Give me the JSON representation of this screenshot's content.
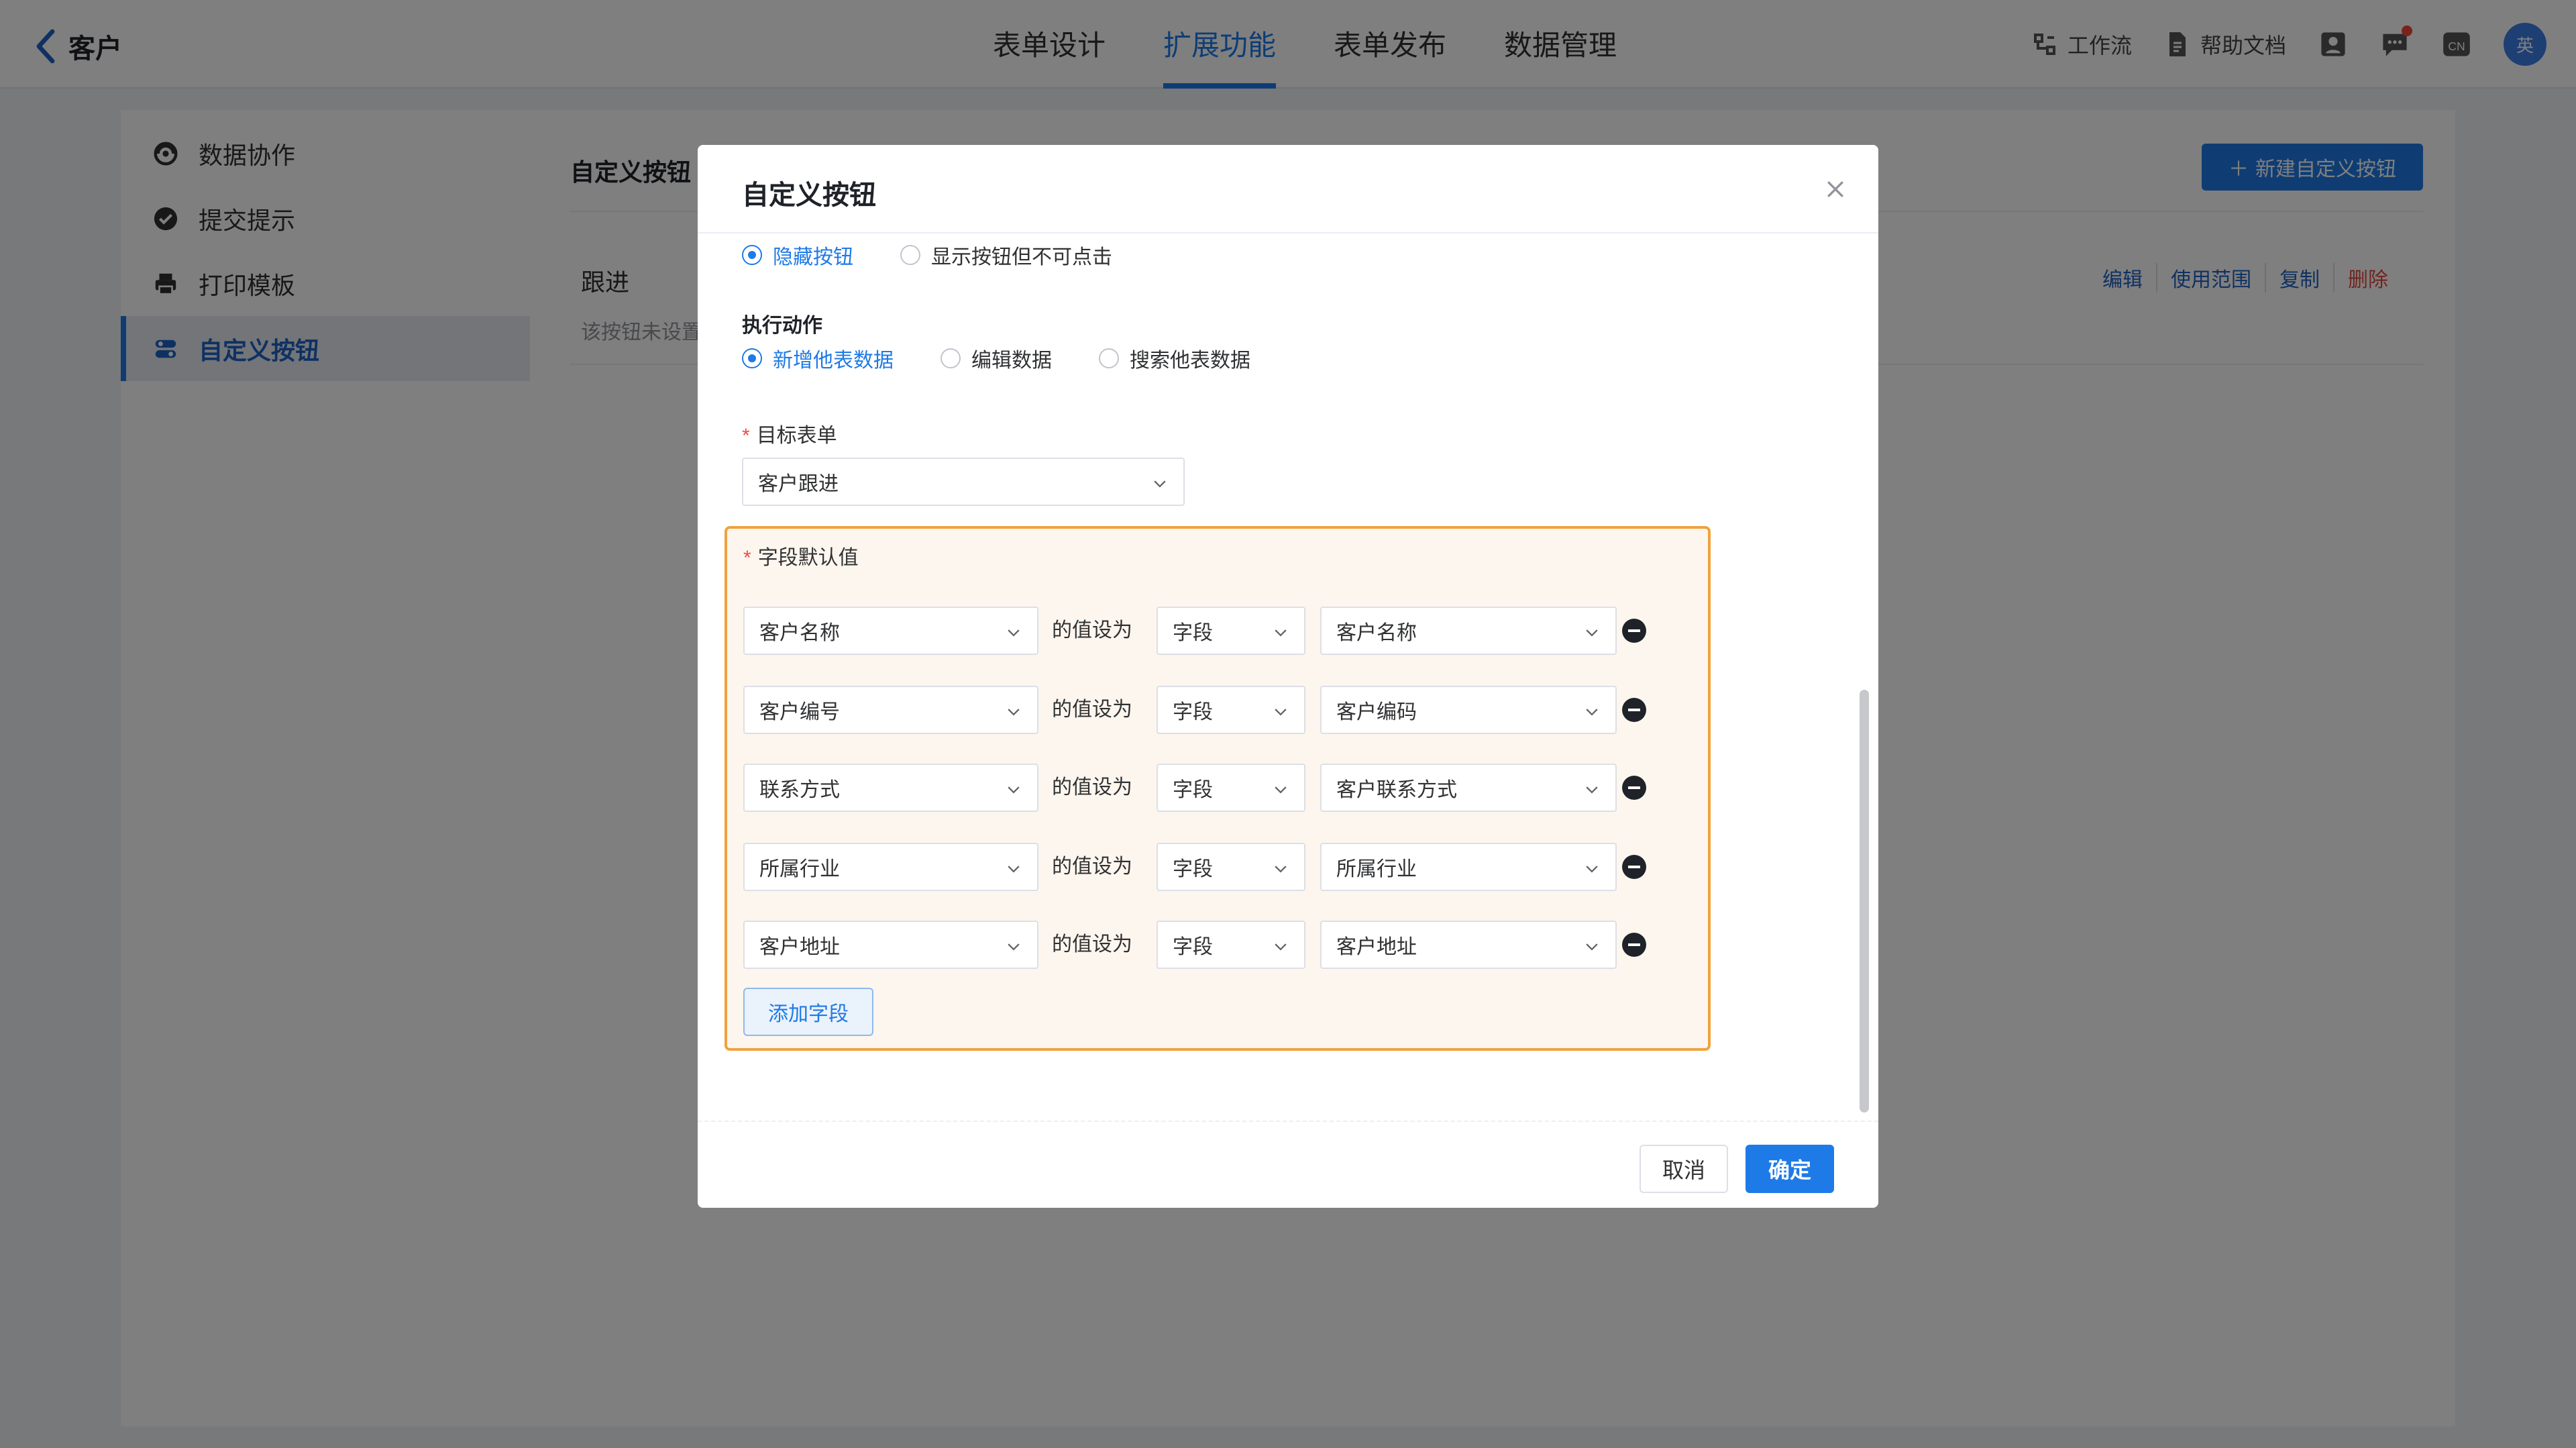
{
  "header": {
    "back_label": "客户",
    "tabs": [
      "表单设计",
      "扩展功能",
      "表单发布",
      "数据管理"
    ],
    "active_tab": "扩展功能",
    "tools": {
      "workflow": "工作流",
      "help": "帮助文档",
      "lang": "CN"
    },
    "avatar_text": "英",
    "accent_color": "#1e7ae6"
  },
  "sidebar": {
    "items": [
      {
        "label": "数据协作",
        "icon": "collaboration-icon"
      },
      {
        "label": "提交提示",
        "icon": "check-circle-icon"
      },
      {
        "label": "打印模板",
        "icon": "printer-icon"
      },
      {
        "label": "自定义按钮",
        "icon": "toggle-icon",
        "active": true
      }
    ]
  },
  "content": {
    "title": "自定义按钮",
    "new_button": "新建自定义按钮",
    "card": {
      "name": "跟进",
      "description": "该按钮未设置",
      "actions": [
        "编辑",
        "使用范围",
        "复制",
        "删除"
      ]
    }
  },
  "modal": {
    "title": "自定义按钮",
    "visibility_options": [
      {
        "label": "隐藏按钮",
        "selected": true
      },
      {
        "label": "显示按钮但不可点击",
        "selected": false
      }
    ],
    "action_label": "执行动作",
    "action_options": [
      {
        "label": "新增他表数据",
        "selected": true
      },
      {
        "label": "编辑数据",
        "selected": false
      },
      {
        "label": "搜索他表数据",
        "selected": false
      }
    ],
    "target_form_label": "目标表单",
    "target_form_value": "客户跟进",
    "fields_label": "字段默认值",
    "set_to_text": "的值设为",
    "rows": [
      {
        "field": "客户名称",
        "type": "字段",
        "source": "客户名称"
      },
      {
        "field": "客户编号",
        "type": "字段",
        "source": "客户编码"
      },
      {
        "field": "联系方式",
        "type": "字段",
        "source": "客户联系方式"
      },
      {
        "field": "所属行业",
        "type": "字段",
        "source": "所属行业"
      },
      {
        "field": "客户地址",
        "type": "字段",
        "source": "客户地址"
      }
    ],
    "add_field_button": "添加字段",
    "cancel_button": "取消",
    "ok_button": "确定",
    "highlight_color": "#f0a23e"
  }
}
